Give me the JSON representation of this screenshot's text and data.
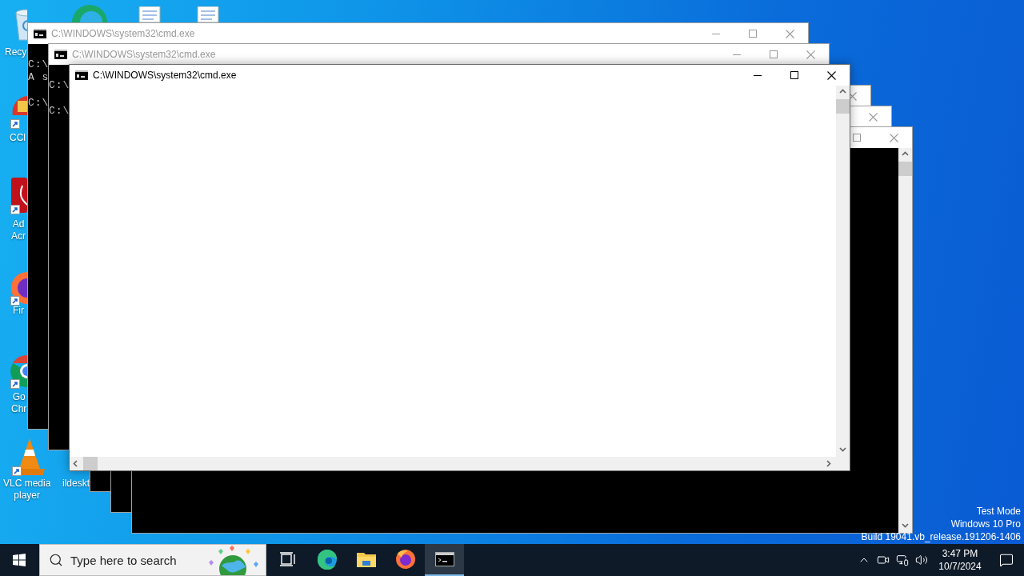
{
  "desktop_icons": [
    {
      "kind": "recycle-bin",
      "label": [
        "Recy"
      ]
    },
    {
      "kind": "browser-swirl"
    },
    {
      "kind": "document"
    },
    {
      "kind": "document"
    },
    {
      "kind": "cleaner",
      "label": [
        "CCl"
      ]
    },
    {
      "kind": "acrobat",
      "label": [
        "Ad",
        "Acr"
      ]
    },
    {
      "kind": "fox",
      "label": [
        "Fir"
      ]
    },
    {
      "kind": "chrome",
      "label": [
        "Go",
        "Chr"
      ]
    },
    {
      "kind": "cone",
      "label": [
        "VLC media",
        "player"
      ]
    },
    {
      "kind": "covered",
      "label": [
        "ildeskt"
      ]
    }
  ],
  "windows": [
    {
      "kind": "console",
      "title": "C:\\WINDOWS\\system32\\cmd.exe",
      "active": false,
      "controls": [
        {
          "kind": "minimize"
        },
        {
          "kind": "maximize"
        },
        {
          "kind": "close"
        }
      ],
      "lines": [
        {
          "text": "C:\\",
          "gap_before": true
        },
        {
          "text": "A s",
          "gap_before": false
        },
        {
          "text": "C:\\",
          "gap_before": true
        }
      ]
    },
    {
      "kind": "console",
      "title": "C:\\WINDOWS\\system32\\cmd.exe",
      "active": false,
      "controls": [
        {
          "kind": "minimize"
        },
        {
          "kind": "maximize"
        },
        {
          "kind": "close"
        }
      ],
      "lines": [
        {
          "text": "C:\\",
          "gap_before": true
        },
        {
          "text": "C:\\",
          "gap_before": true
        }
      ]
    },
    {
      "kind": "console",
      "active": false,
      "controls": [
        {
          "kind": "close"
        }
      ]
    },
    {
      "kind": "console",
      "active": false,
      "controls": [
        {
          "kind": "close"
        }
      ]
    },
    {
      "kind": "console",
      "active": false,
      "controls": [
        {
          "kind": "maximize"
        },
        {
          "kind": "close"
        }
      ],
      "scrollbars": [
        {
          "kind": "vertical"
        }
      ]
    },
    {
      "kind": "blank",
      "title": "C:\\WINDOWS\\system32\\cmd.exe",
      "active": true,
      "controls": [
        {
          "kind": "minimize"
        },
        {
          "kind": "maximize"
        },
        {
          "kind": "close"
        }
      ],
      "scrollbars": [
        {
          "kind": "vertical"
        },
        {
          "kind": "horizontal"
        }
      ]
    }
  ],
  "system_watermark": [
    "Test Mode",
    "Windows 10 Pro",
    "Build 19041.vb_release.191206-1406"
  ],
  "taskbar": {
    "search": {
      "placeholder": "Type here to search"
    },
    "apps": [
      {
        "kind": "task-view",
        "selected": false
      },
      {
        "kind": "edge",
        "selected": false
      },
      {
        "kind": "folder",
        "selected": false
      },
      {
        "kind": "fox",
        "selected": false
      },
      {
        "kind": "terminal",
        "selected": true
      }
    ],
    "tray": {
      "icons": [
        {
          "kind": "chevron"
        },
        {
          "kind": "camera"
        },
        {
          "kind": "network"
        },
        {
          "kind": "volume"
        }
      ],
      "time": "3:47 PM",
      "date": "10/7/2024"
    }
  }
}
